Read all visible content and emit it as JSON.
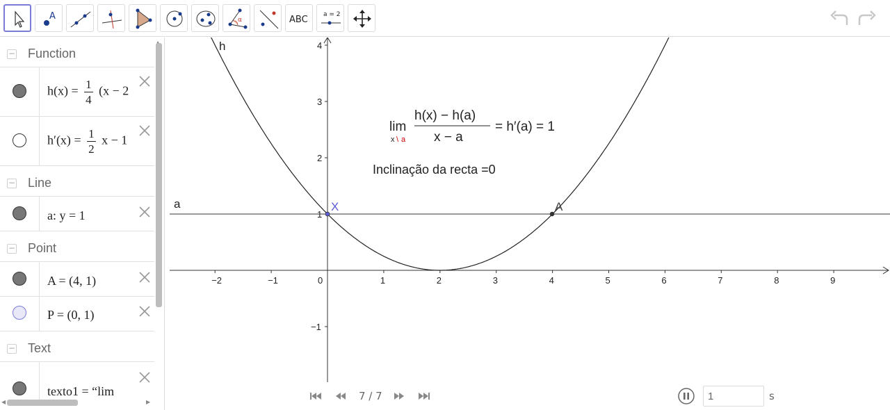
{
  "toolbar": {
    "tools": [
      {
        "name": "move-tool",
        "icon": "arrow-cursor-icon",
        "active": true
      },
      {
        "name": "point-tool",
        "icon": "point-icon",
        "label": "A"
      },
      {
        "name": "line-tool",
        "icon": "line-icon"
      },
      {
        "name": "perpendicular-tool",
        "icon": "perpendicular-icon"
      },
      {
        "name": "polygon-tool",
        "icon": "polygon-icon"
      },
      {
        "name": "circle-tool",
        "icon": "circle-icon"
      },
      {
        "name": "ellipse-tool",
        "icon": "ellipse-icon"
      },
      {
        "name": "angle-tool",
        "icon": "angle-icon",
        "label": "α"
      },
      {
        "name": "reflect-tool",
        "icon": "reflect-icon"
      },
      {
        "name": "text-tool",
        "icon": "text-icon",
        "label": "ABC"
      },
      {
        "name": "slider-tool",
        "icon": "slider-icon",
        "label": "a = 2"
      },
      {
        "name": "move-graphics-tool",
        "icon": "move-arrows-icon"
      }
    ],
    "undo_icon": "undo-icon",
    "redo_icon": "redo-icon"
  },
  "algebra": {
    "categories": {
      "function": "Function",
      "line": "Line",
      "point": "Point",
      "text": "Text"
    },
    "items": {
      "h": {
        "lhs": "h(x)",
        "frac_num": "1",
        "frac_den": "4",
        "rest": "(x − 2"
      },
      "hprime": {
        "lhs": "h′(x)",
        "frac_num": "1",
        "frac_den": "2",
        "rest": "x − 1"
      },
      "a": {
        "text": "a: y = 1"
      },
      "A": {
        "text": "A = (4, 1)"
      },
      "P": {
        "text": "P = (0, 1)"
      },
      "texto1": {
        "text": "texto1 = “lim"
      }
    }
  },
  "graphics": {
    "curve_label": "h",
    "line_label": "a",
    "point_A_label": "A",
    "point_P_label": "X",
    "formula": {
      "lim": "lim",
      "lim_sub_x": "x",
      "lim_sub_arrow": "\\",
      "lim_sub_a": "a",
      "num": "h(x) − h(a)",
      "den": "x − a",
      "rhs": "= h′(a) = 1"
    },
    "slope_text": "Inclinação da recta =0",
    "x_ticks": [
      "−2",
      "−1",
      "0",
      "1",
      "2",
      "3",
      "4",
      "5",
      "6",
      "7",
      "8",
      "9"
    ],
    "y_ticks": [
      "4",
      "3",
      "2",
      "1",
      "−1"
    ],
    "colors": {
      "point_A": "#333333",
      "point_P": "#5c5cd6",
      "accent": "#7c7cd6",
      "limit_sub": "#cc0000"
    }
  },
  "animation": {
    "frame": "7 / 7",
    "speed_value": "1",
    "speed_unit": "s"
  }
}
